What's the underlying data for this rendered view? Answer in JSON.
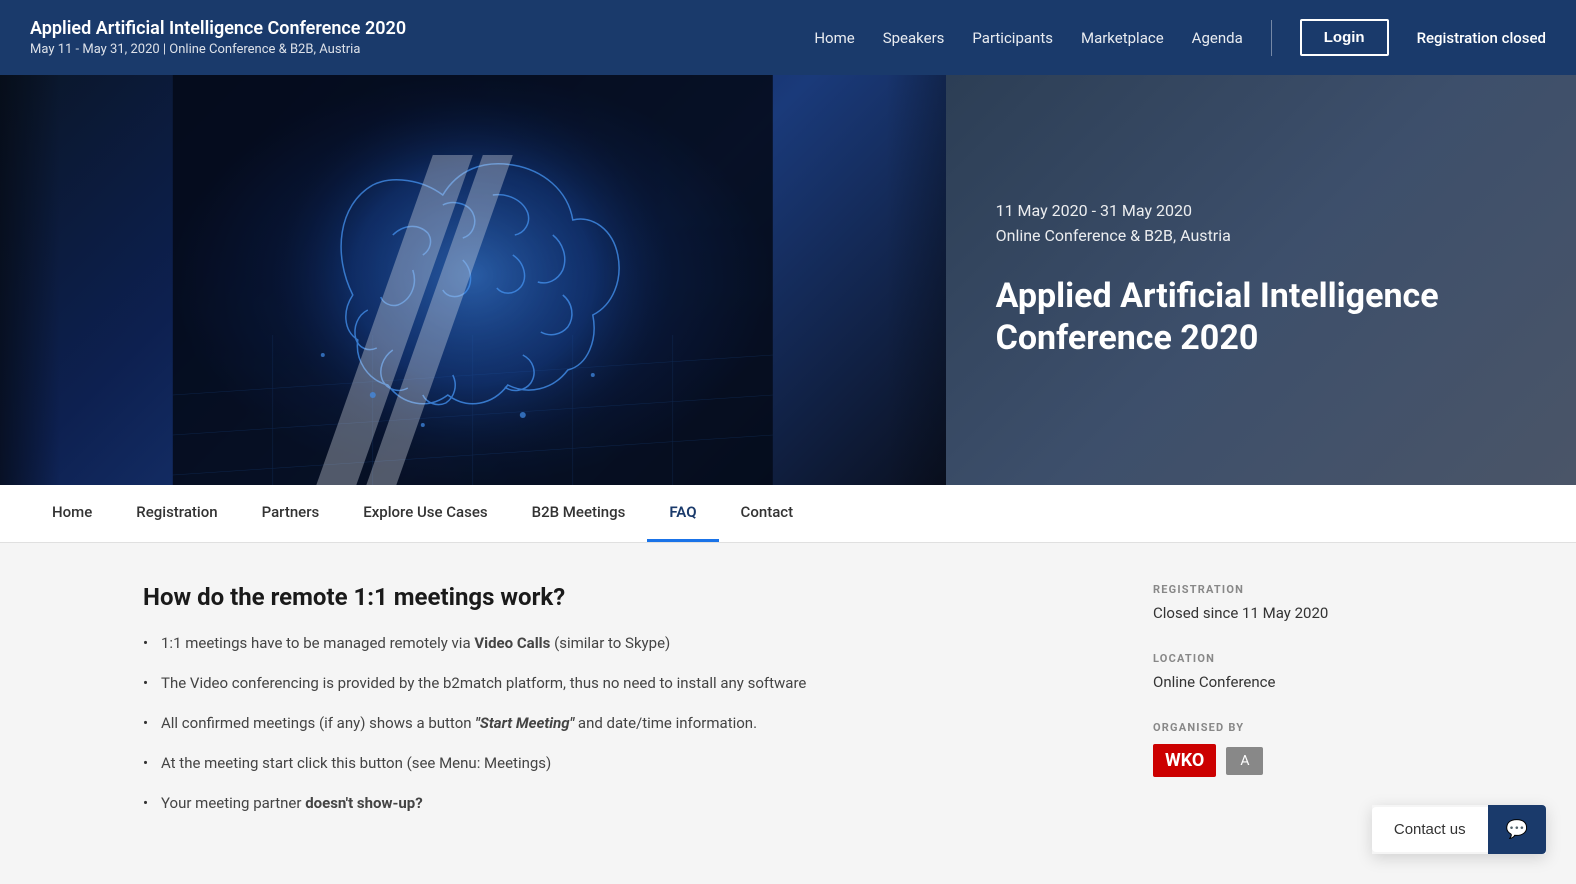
{
  "header": {
    "title": "Applied Artificial Intelligence Conference 2020",
    "subtitle": "May 11 - May 31, 2020 | Online Conference & B2B, Austria",
    "nav": {
      "home": "Home",
      "speakers": "Speakers",
      "participants": "Participants",
      "marketplace": "Marketplace",
      "agenda": "Agenda"
    },
    "login_label": "Login",
    "registration_closed": "Registration closed"
  },
  "hero": {
    "dates": "11 May 2020 - 31 May 2020",
    "location": "Online Conference & B2B, Austria",
    "conference_title": "Applied Artificial Intelligence Conference 2020"
  },
  "sub_nav": {
    "items": [
      {
        "label": "Home",
        "active": false
      },
      {
        "label": "Registration",
        "active": false
      },
      {
        "label": "Partners",
        "active": false
      },
      {
        "label": "Explore Use Cases",
        "active": false
      },
      {
        "label": "B2B Meetings",
        "active": false
      },
      {
        "label": "FAQ",
        "active": true
      },
      {
        "label": "Contact",
        "active": false
      }
    ]
  },
  "faq": {
    "title": "How do the remote 1:1 meetings work?",
    "items": [
      {
        "text_before": "1:1 meetings have to be managed remotely via ",
        "bold": "Video Calls",
        "text_after": " (similar to Skype)"
      },
      {
        "text_before": "The Video conferencing is provided by the b2match platform, thus no need to install any software",
        "bold": "",
        "text_after": ""
      },
      {
        "text_before": "All confirmed meetings (if any) shows a button ",
        "bold_italic": "\"Start Meeting\"",
        "text_after": " and date/time information."
      },
      {
        "text_before": "At the meeting start click this button (see Menu: Meetings)",
        "bold": "",
        "text_after": ""
      },
      {
        "text_before": "Your meeting partner ",
        "bold": "doesn't show-up?",
        "text_after": ""
      }
    ]
  },
  "sidebar": {
    "registration_label": "REGISTRATION",
    "registration_value": "Closed since 11 May 2020",
    "location_label": "LOCATION",
    "location_value": "Online Conference",
    "organised_label": "ORGANISED BY"
  },
  "contact_widget": {
    "button_label": "Contact us",
    "icon": "💬"
  }
}
